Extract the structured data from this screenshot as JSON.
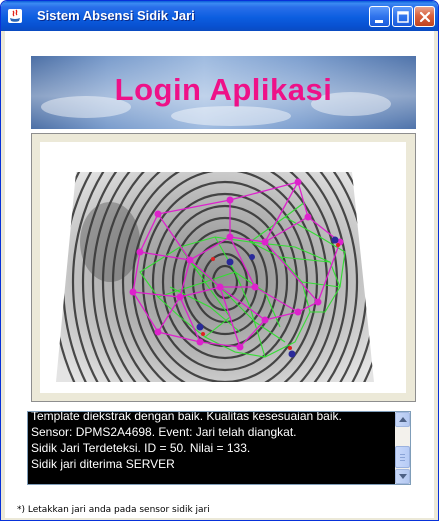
{
  "window": {
    "title": "Sistem Absensi Sidik Jari",
    "app_icon": "java-icon"
  },
  "banner": {
    "title": "Login Aplikasi",
    "title_color": "#ee1188"
  },
  "fingerprint": {
    "icon": "fingerprint-scan-image",
    "minutiae_color": "#dd22cc",
    "ridge_graph_color": "#33dd33"
  },
  "log": {
    "lines": [
      "Template diekstrak dengan baik. Kualitas kesesuaian baik.",
      "Sensor: DPMS2A4698. Event: Jari telah diangkat.",
      "Sidik Jari Terdeteksi. ID = 50. Nilai = 133.",
      "Sidik jari diterima SERVER"
    ]
  },
  "footer": {
    "note": "*) Letakkan jari anda pada sensor sidik jari"
  }
}
